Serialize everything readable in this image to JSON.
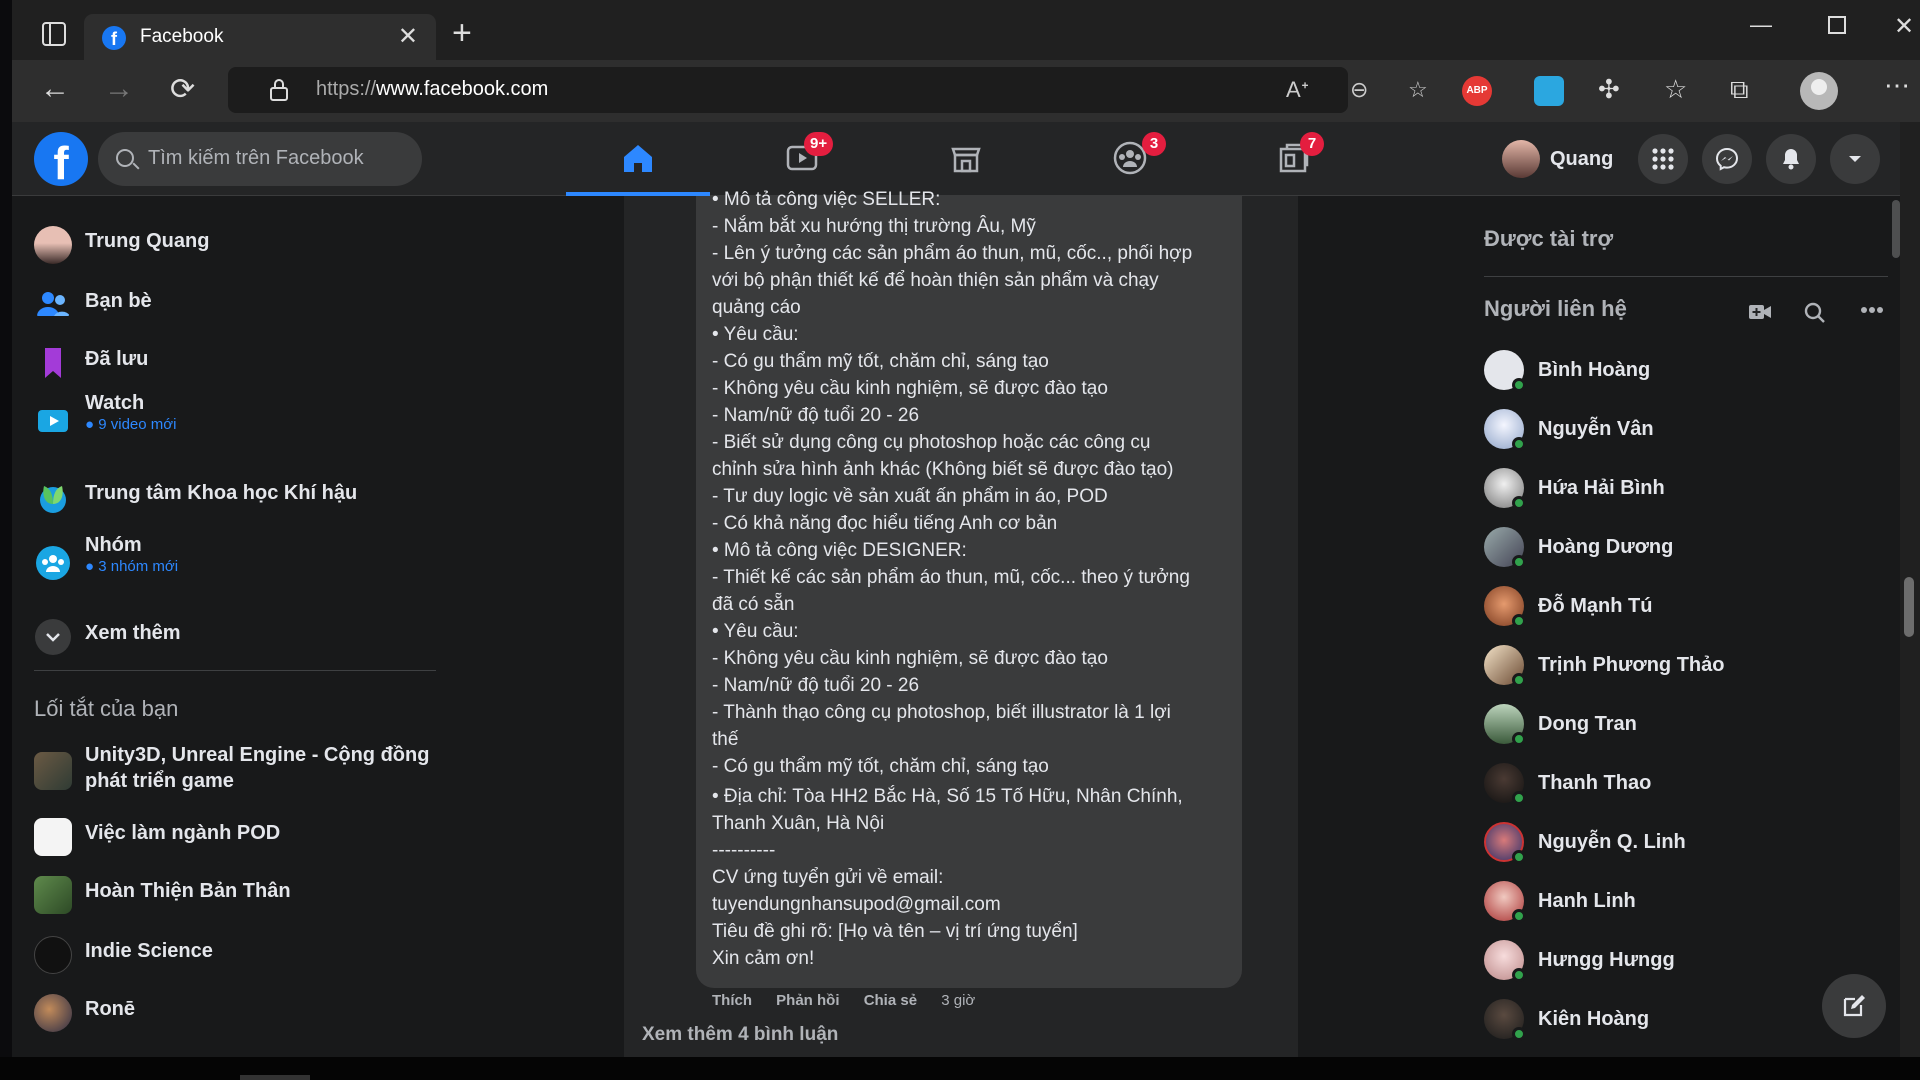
{
  "browser": {
    "tab_title": "Facebook",
    "url_scheme": "https://",
    "url_host": "www.facebook.com",
    "extensions": [
      "ABP"
    ]
  },
  "header": {
    "search_placeholder": "Tìm kiếm trên Facebook",
    "badges": {
      "watch": "9+",
      "groups": "3",
      "gaming": "7"
    },
    "user_name": "Quang"
  },
  "sidebar": {
    "items": [
      {
        "label": "Trung Quang"
      },
      {
        "label": "Bạn bè"
      },
      {
        "label": "Đã lưu"
      },
      {
        "label": "Watch",
        "sub": "9 video mới"
      },
      {
        "label": "Trung tâm Khoa học Khí hậu"
      },
      {
        "label": "Nhóm",
        "sub": "3 nhóm mới"
      },
      {
        "label": "Xem thêm"
      }
    ],
    "shortcuts_title": "Lối tắt của bạn",
    "shortcuts": [
      {
        "line1": "Unity3D, Unreal Engine - Cộng đồng",
        "line2": "phát triển game"
      },
      {
        "label": "Việc làm ngành POD"
      },
      {
        "label": "Hoàn Thiện Bản Thân"
      },
      {
        "label": "Indie Science"
      },
      {
        "label": "Ronē"
      }
    ]
  },
  "post": {
    "lines": [
      "• Mô tả công việc SELLER:",
      "- Nắm bắt xu hướng thị trường Âu, Mỹ",
      "- Lên ý tưởng các sản phẩm áo thun, mũ, cốc.., phối hợp",
      "với bộ phận thiết kế để hoàn thiện sản phẩm và chạy",
      "quảng cáo",
      "• Yêu cầu:",
      "- Có gu thẩm mỹ tốt, chăm chỉ, sáng tạo",
      "- Không yêu cầu kinh nghiệm, sẽ được đào tạo",
      "- Nam/nữ độ tuổi 20 - 26",
      "- Biết sử dụng công cụ photoshop hoặc các công cụ",
      "chỉnh sửa hình ảnh khác (Không biết sẽ được đào tạo)",
      "- Tư duy logic về sản xuất ấn phẩm in áo, POD",
      "- Có khả năng đọc hiểu tiếng Anh cơ bản",
      "• Mô tả công việc DESIGNER:",
      "- Thiết kế các sản phẩm áo thun, mũ, cốc... theo ý tưởng",
      "đã có sẵn",
      "• Yêu cầu:",
      "- Không yêu cầu kinh nghiệm, sẽ được đào tạo",
      "- Nam/nữ độ tuổi 20 - 26",
      "- Thành thạo công cụ photoshop, biết illustrator là 1 lợi",
      "thế",
      "- Có gu thẩm mỹ tốt, chăm chỉ, sáng tạo"
    ],
    "lines2": [
      "• Địa chỉ: Tòa HH2 Bắc Hà, Số 15 Tố Hữu, Nhân Chính,",
      "Thanh Xuân, Hà Nội",
      "----------",
      "CV ứng tuyển gửi về email:",
      "tuyendungnhansupod@gmail.com",
      "Tiêu đề ghi rõ: [Họ và tên – vị trí ứng tuyển]",
      "Xin cảm ơn!"
    ],
    "like": "Thích",
    "reply": "Phản hồi",
    "share": "Chia sẻ",
    "time": "3 giờ",
    "more_comments": "Xem thêm 4 bình luận"
  },
  "right": {
    "sponsored": "Được tài trợ",
    "contacts_title": "Người liên hệ",
    "contacts": [
      "Bình Hoàng",
      "Nguyễn Vân",
      "Hứa Hải Bình",
      "Hoàng Dương",
      "Đỗ Mạnh Tú",
      "Trịnh Phương Thảo",
      "Dong Tran",
      "Thanh Thao",
      "Nguyễn Q. Linh",
      "Hanh Linh",
      "Hưngg Hưngg",
      "Kiên Hoàng"
    ]
  },
  "colors": {
    "brand": "#1877f2",
    "badge": "#e41e3f",
    "online": "#31a24c",
    "bg": "#18191a"
  }
}
